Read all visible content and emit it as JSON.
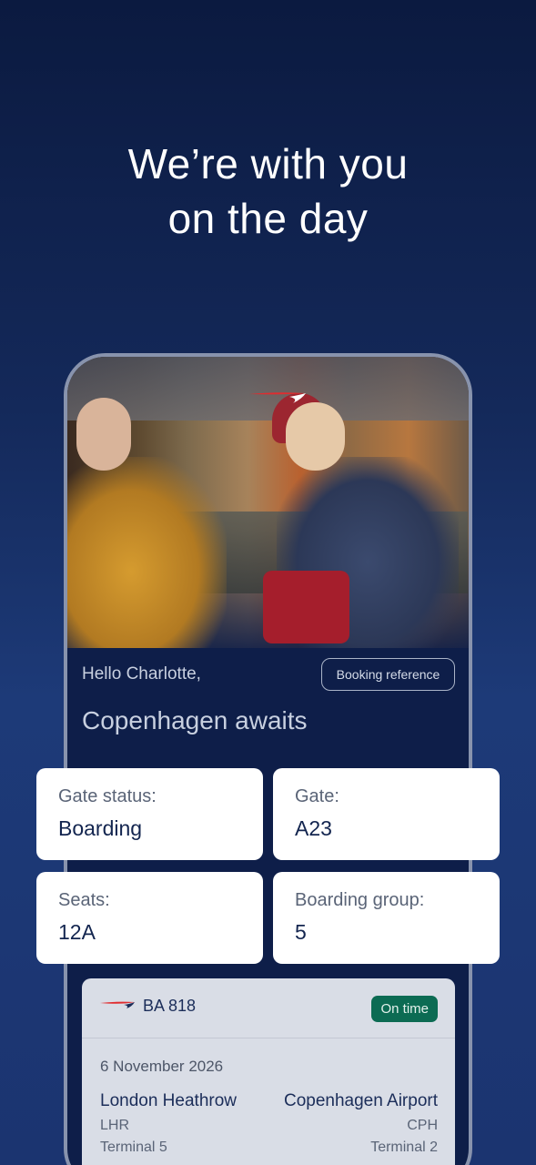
{
  "headline": {
    "line1": "We’re with you",
    "line2": "on the day"
  },
  "app": {
    "greeting": "Hello Charlotte,",
    "booking_reference_label": "Booking reference",
    "destination": "Copenhagen awaits"
  },
  "cards": [
    {
      "label": "Gate status:",
      "value": "Boarding"
    },
    {
      "label": "Gate:",
      "value": "A23"
    },
    {
      "label": "Seats:",
      "value": "12A"
    },
    {
      "label": "Boarding group:",
      "value": "5"
    }
  ],
  "flight": {
    "number": "BA 818",
    "status": "On time",
    "date": "6 November 2026",
    "from": {
      "city": "London Heathrow",
      "code": "LHR",
      "terminal": "Terminal 5"
    },
    "to": {
      "city": "Copenhagen Airport",
      "code": "CPH",
      "terminal": "Terminal 2"
    }
  },
  "colors": {
    "background": "#14295a",
    "brand_red": "#e02c2f",
    "status_green": "#0c6b53",
    "card_bg": "#ffffff"
  },
  "icons": {
    "brand_logo": "speedmarque-logo-icon"
  }
}
